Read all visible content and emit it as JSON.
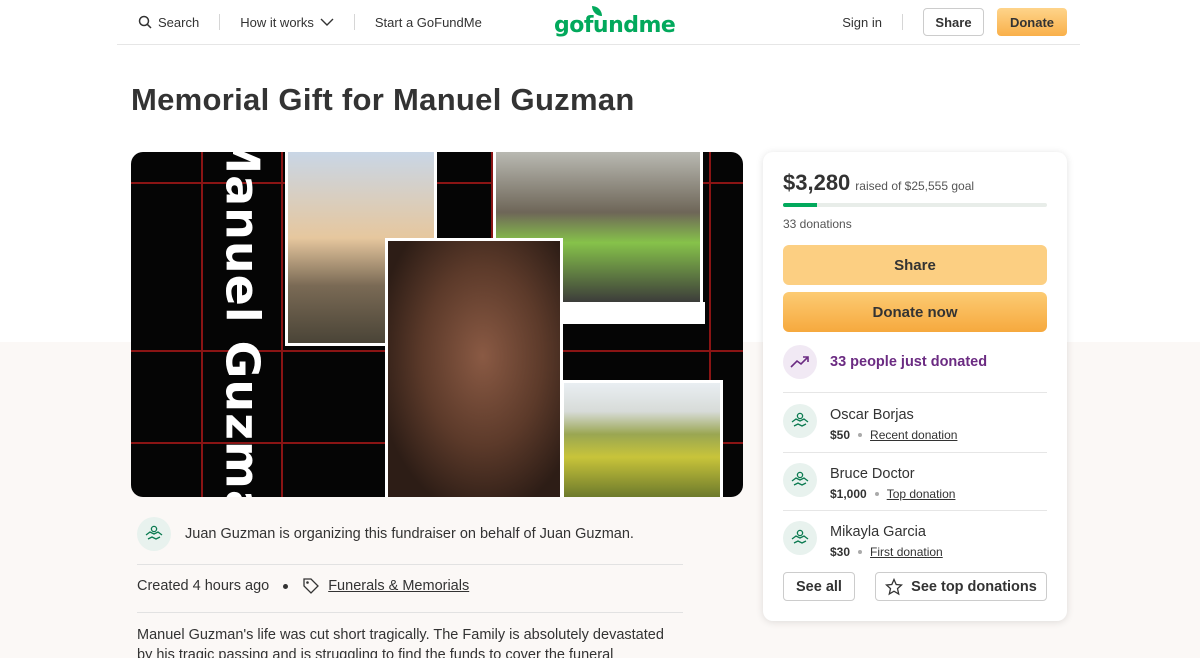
{
  "header": {
    "search_label": "Search",
    "how_it_works_label": "How it works",
    "start_label": "Start a GoFundMe",
    "logo_text": "gofundme",
    "sign_in_label": "Sign in",
    "share_label": "Share",
    "donate_label": "Donate"
  },
  "campaign": {
    "title": "Memorial Gift for Manuel Guzman",
    "hero_name_text": "Manuel Guzman",
    "organizer_text": "Juan Guzman is organizing this fundraiser on behalf of Juan Guzman.",
    "created_text": "Created 4 hours ago",
    "category": "Funerals & Memorials",
    "story": "Manuel Guzman's life was cut short tragically. The Family is absolutely devastated by his tragic passing and is struggling to find the funds to cover the funeral expenses. Please"
  },
  "sidebar": {
    "raised_amount": "$3,280",
    "raised_goal_text": "raised of $25,555 goal",
    "progress_percent": 12.8,
    "donations_count": "33 donations",
    "share_label": "Share",
    "donate_now_label": "Donate now",
    "recent_text": "33 people just donated",
    "donors": [
      {
        "name": "Oscar Borjas",
        "amount": "$50",
        "tag": "Recent donation"
      },
      {
        "name": "Bruce Doctor",
        "amount": "$1,000",
        "tag": "Top donation"
      },
      {
        "name": "Mikayla Garcia",
        "amount": "$30",
        "tag": "First donation"
      }
    ],
    "see_all_label": "See all",
    "see_top_label": "See top donations"
  },
  "colors": {
    "brand_green": "#02a95c",
    "donate_orange": "#f9b04a",
    "accent_purple": "#6b2b82"
  },
  "icons": [
    "search-icon",
    "chevron-down-icon",
    "donor-hands-icon",
    "trend-up-icon",
    "tag-icon",
    "star-icon"
  ]
}
